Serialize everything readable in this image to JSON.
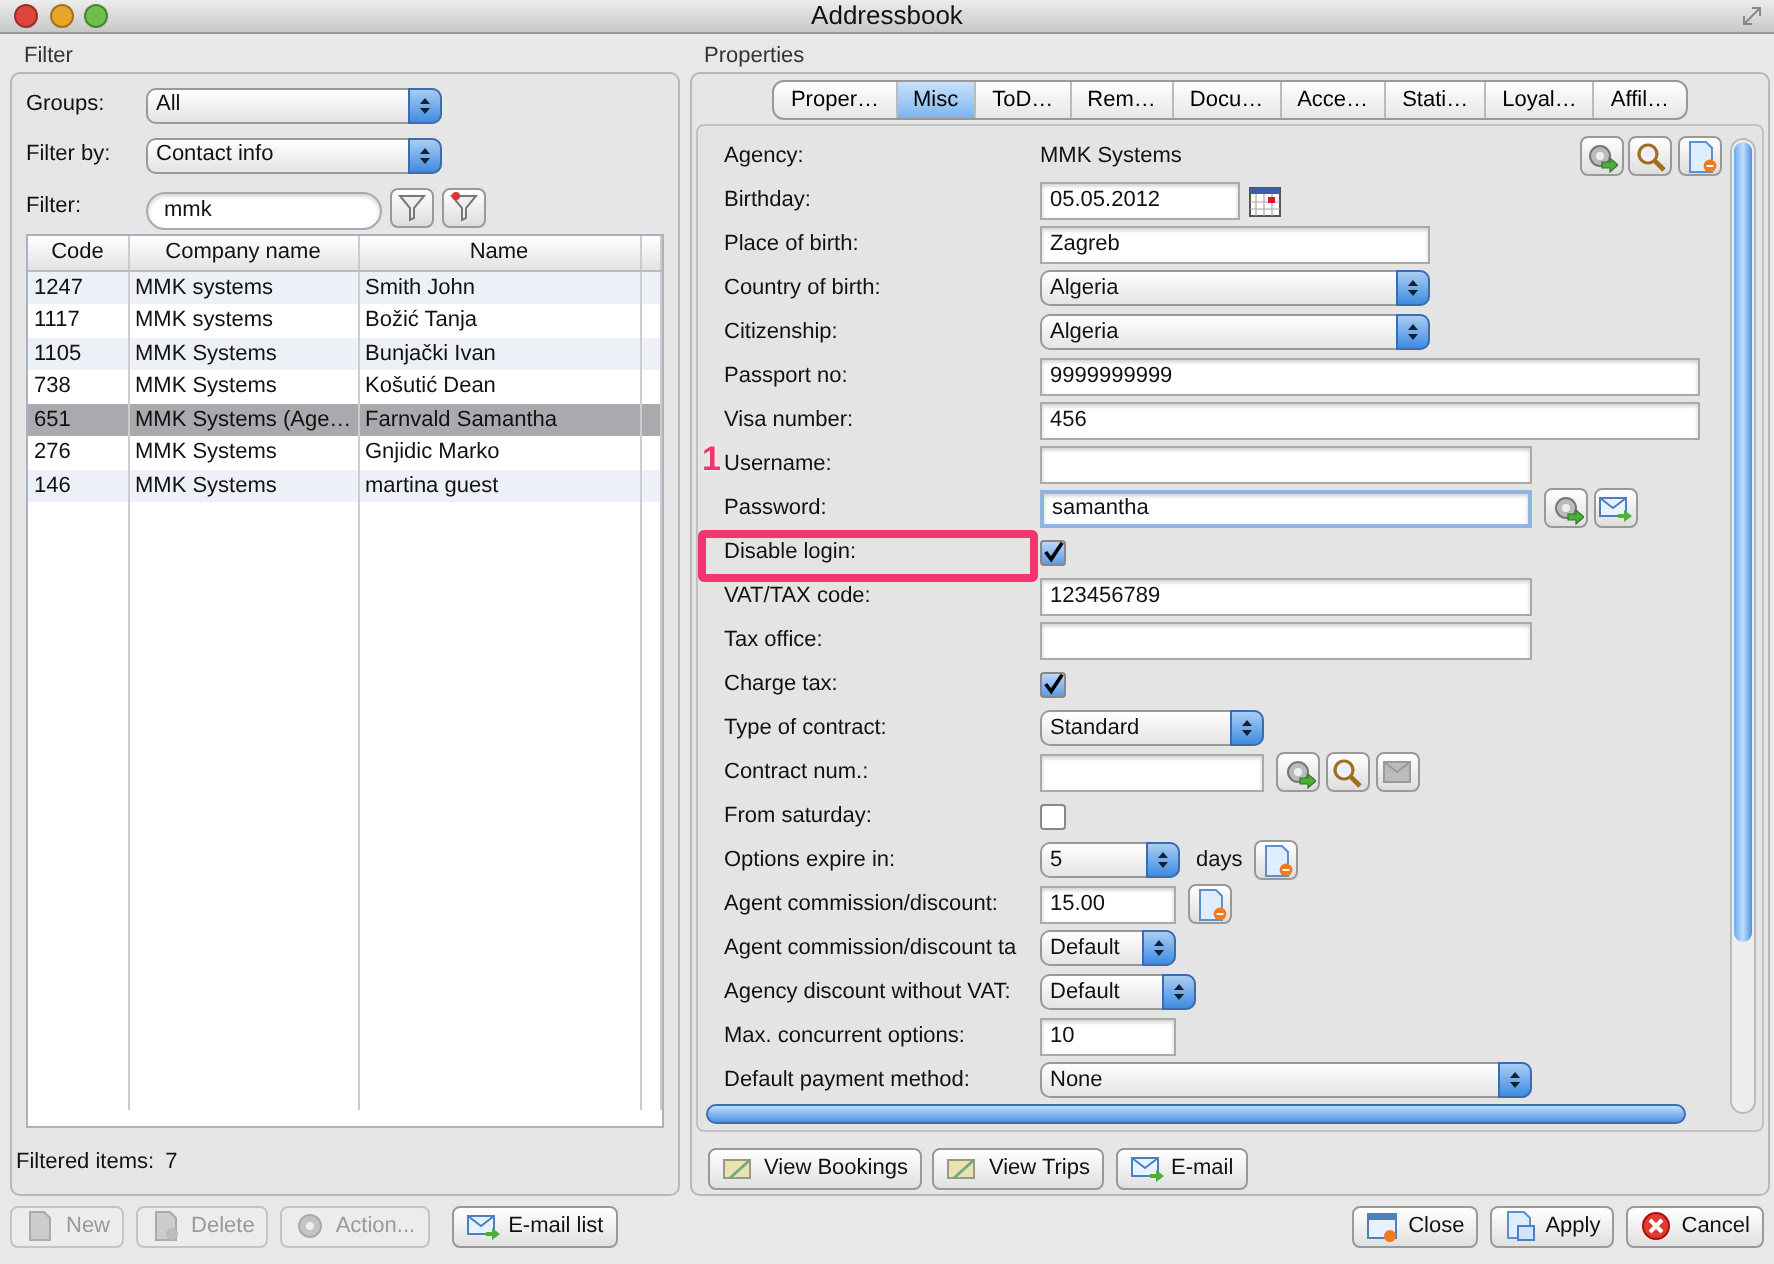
{
  "window": {
    "title": "Addressbook"
  },
  "filter_panel": {
    "title": "Filter",
    "groups": {
      "label": "Groups:",
      "value": "All"
    },
    "filter_by": {
      "label": "Filter by:",
      "value": "Contact info"
    },
    "filter": {
      "label": "Filter:",
      "value": "mmk"
    },
    "table": {
      "columns": [
        "Code",
        "Company name",
        "Name",
        ""
      ],
      "rows": [
        {
          "cells": [
            "1247",
            "MMK systems",
            "Smith John"
          ],
          "selected": false
        },
        {
          "cells": [
            "1117",
            "MMK systems",
            "Božić Tanja"
          ],
          "selected": false
        },
        {
          "cells": [
            "1105",
            "MMK Systems",
            "Bunjački Ivan"
          ],
          "selected": false
        },
        {
          "cells": [
            "738",
            "MMK Systems",
            "Košutić Dean"
          ],
          "selected": false
        },
        {
          "cells": [
            "651",
            "MMK Systems (Age…",
            "Farnvald Samantha"
          ],
          "selected": true
        },
        {
          "cells": [
            "276",
            "MMK Systems",
            "Gnjidic Marko"
          ],
          "selected": false
        },
        {
          "cells": [
            "146",
            "MMK Systems",
            "martina guest"
          ],
          "selected": false
        }
      ]
    },
    "filtered_label": "Filtered items:",
    "filtered_count": "7"
  },
  "properties_panel": {
    "title": "Properties",
    "tabs": [
      {
        "label": "Proper…",
        "selected": false
      },
      {
        "label": "Misc",
        "selected": true
      },
      {
        "label": "ToD…",
        "selected": false
      },
      {
        "label": "Rem…",
        "selected": false
      },
      {
        "label": "Docu…",
        "selected": false
      },
      {
        "label": "Acce…",
        "selected": false
      },
      {
        "label": "Stati…",
        "selected": false
      },
      {
        "label": "Loyal…",
        "selected": false
      },
      {
        "label": "Affil…",
        "selected": false
      }
    ],
    "fields": [
      {
        "label": "Agency:",
        "kind": "static",
        "value": "MMK Systems"
      },
      {
        "label": "Birthday:",
        "kind": "date",
        "value": "05.05.2012"
      },
      {
        "label": "Place of birth:",
        "kind": "input",
        "value": "Zagreb"
      },
      {
        "label": "Country of birth:",
        "kind": "select",
        "value": "Algeria"
      },
      {
        "label": "Citizenship:",
        "kind": "select",
        "value": "Algeria"
      },
      {
        "label": "Passport no:",
        "kind": "input",
        "value": "9999999999"
      },
      {
        "label": "Visa number:",
        "kind": "input",
        "value": "456"
      },
      {
        "label": "Username:",
        "kind": "input"
      },
      {
        "label": "Password:",
        "kind": "input",
        "value": "samantha",
        "focused": true
      },
      {
        "label": "Disable login:",
        "kind": "checkbox",
        "checked": true
      },
      {
        "label": "VAT/TAX code:",
        "kind": "input",
        "value": "123456789"
      },
      {
        "label": "Tax office:",
        "kind": "input"
      },
      {
        "label": "Charge tax:",
        "kind": "checkbox",
        "checked": true
      },
      {
        "label": "Type of contract:",
        "kind": "select",
        "value": "Standard"
      },
      {
        "label": "Contract num.:",
        "kind": "input"
      },
      {
        "label": "From saturday:",
        "kind": "checkbox",
        "checked": false
      },
      {
        "label": "Options expire in:",
        "kind": "select",
        "value": "5",
        "suffix": "days"
      },
      {
        "label": "Agent commission/discount:",
        "kind": "input",
        "value": "15.00"
      },
      {
        "label": "Agent commission/discount ta",
        "kind": "select",
        "value": "Default"
      },
      {
        "label": "Agency discount without VAT:",
        "kind": "select",
        "value": "Default"
      },
      {
        "label": "Max. concurrent options:",
        "kind": "input",
        "value": "10"
      },
      {
        "label": "Default payment method:",
        "kind": "select",
        "value": "None"
      }
    ],
    "annotation": {
      "number": "1"
    },
    "buttons": [
      {
        "label": "View Bookings"
      },
      {
        "label": "View Trips"
      },
      {
        "label": "E-mail"
      }
    ]
  },
  "footer": {
    "left_buttons": [
      {
        "label": "New",
        "disabled": true
      },
      {
        "label": "Delete",
        "disabled": true
      },
      {
        "label": "Action...",
        "disabled": true
      },
      {
        "label": "E-mail list",
        "disabled": false
      }
    ],
    "right_buttons": [
      {
        "label": "Close"
      },
      {
        "label": "Apply"
      },
      {
        "label": "Cancel"
      }
    ]
  }
}
